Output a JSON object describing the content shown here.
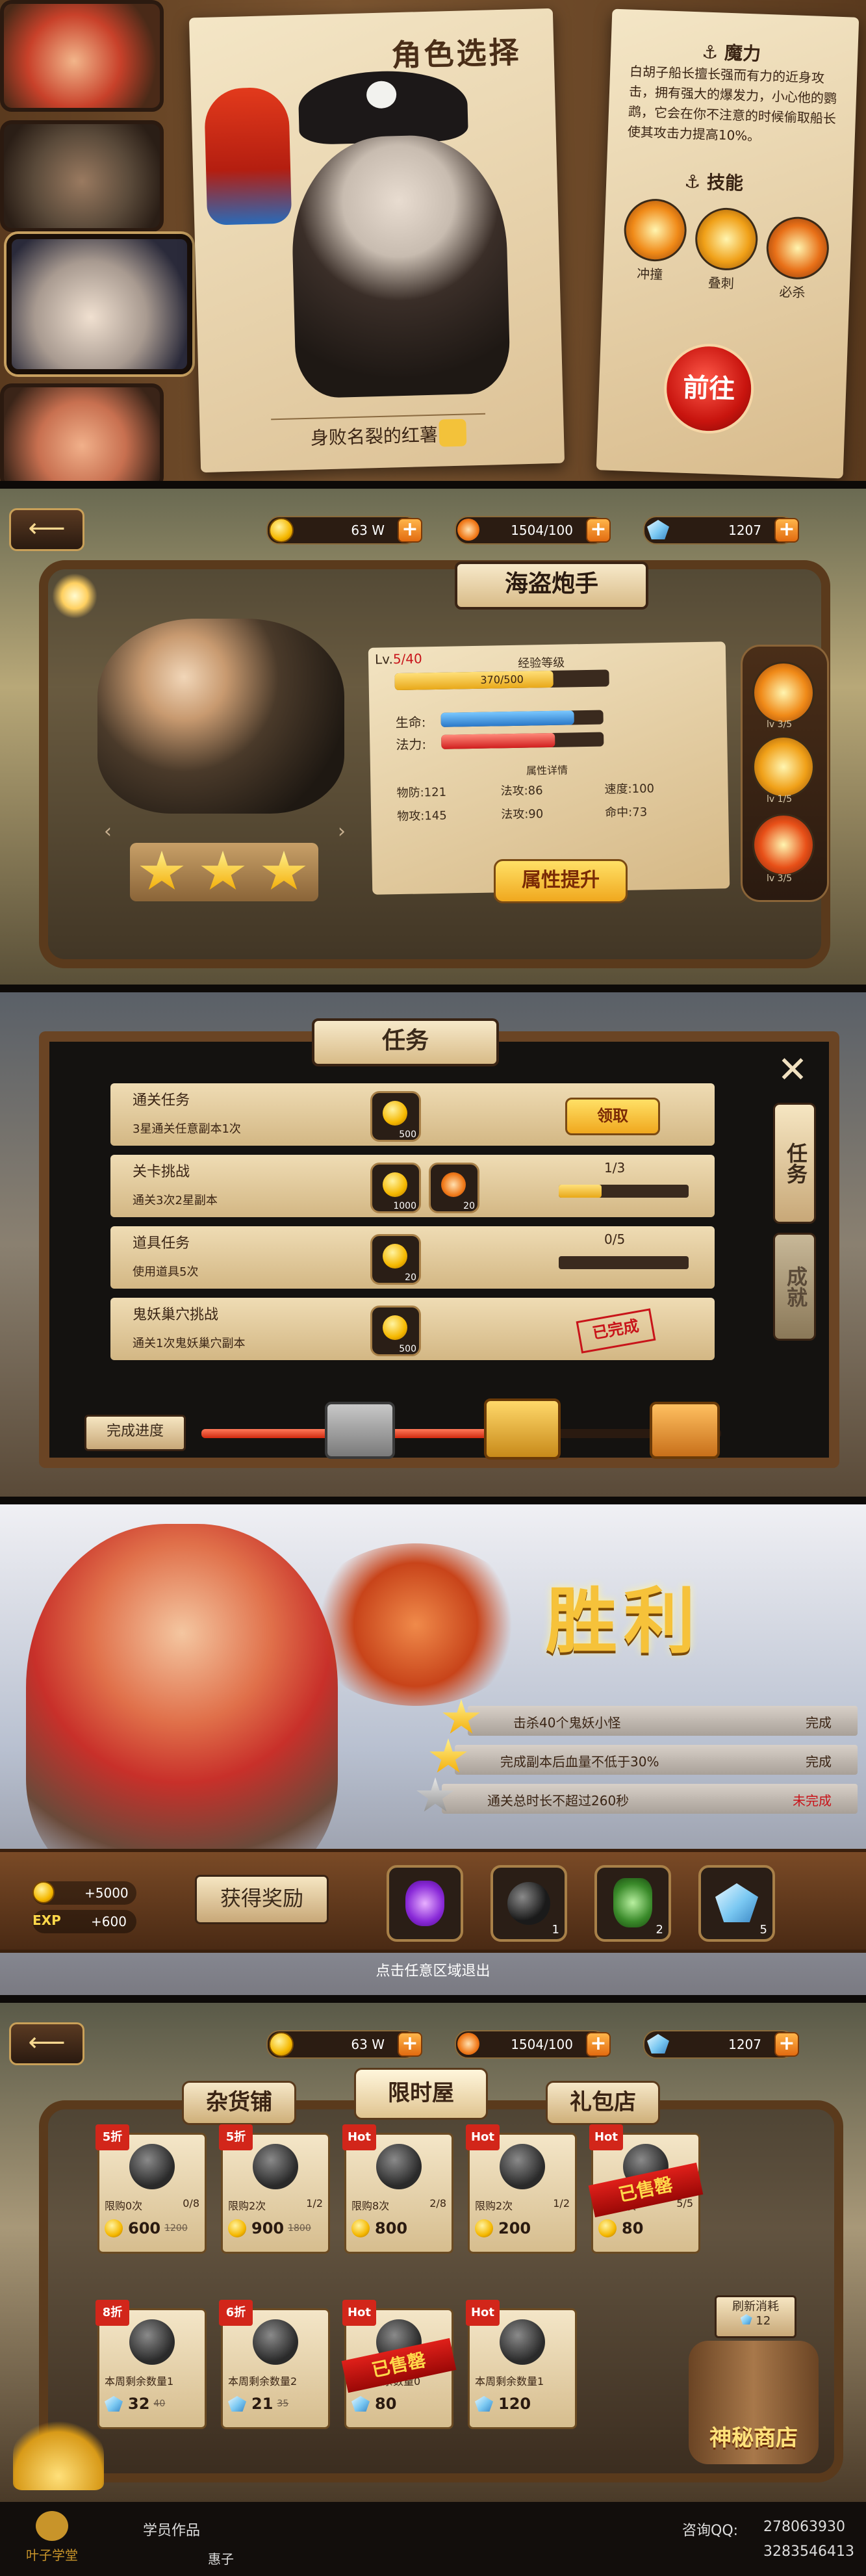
{
  "p1": {
    "title": "角色选择",
    "character_name": "身败名裂的红薯",
    "ability_header": "魔力",
    "description": "白胡子船长擅长强而有力的近身攻击，拥有强大的爆发力，小心他的鹦鹉，它会在你不注意的时候偷取船长使其攻击力提高10%。",
    "skills_header": "技能",
    "skills": [
      "冲撞",
      "叠刺",
      "必杀"
    ],
    "go_button": "前往"
  },
  "p2": {
    "resources": {
      "gold": "63 W",
      "stamina": "1504/100",
      "gems": "1207"
    },
    "title": "海盗炮手",
    "level_label": "Lv.",
    "level_value": "5/40",
    "exp_label": "经验等级",
    "exp_value": "370/500",
    "exp_fraction": 0.74,
    "hp_label": "生命:",
    "mp_label": "法力:",
    "hp_fraction": 0.82,
    "mp_fraction": 0.7,
    "attr_header": "属性详情",
    "attrs": [
      {
        "label": "物防:",
        "value": "121"
      },
      {
        "label": "法攻:",
        "value": "86"
      },
      {
        "label": "速度:",
        "value": "100"
      },
      {
        "label": "物攻:",
        "value": "145"
      },
      {
        "label": "法攻:",
        "value": "90"
      },
      {
        "label": "命中:",
        "value": "73"
      }
    ],
    "upgrade_button": "属性提升",
    "skill_levels": [
      "lv 3/5",
      "lv 1/5",
      "lv 3/5"
    ],
    "stars": 3
  },
  "p3": {
    "title": "任务",
    "quests": [
      {
        "name": "通关任务",
        "desc": "3星通关任意副本1次",
        "reward1": "500",
        "reward2": "",
        "status": "领取",
        "progress": "",
        "fraction": 1
      },
      {
        "name": "关卡挑战",
        "desc": "通关3次2星副本",
        "reward1": "1000",
        "reward2": "20",
        "status": "",
        "progress": "1/3",
        "fraction": 0.33
      },
      {
        "name": "道具任务",
        "desc": "使用道具5次",
        "reward1": "20",
        "reward2": "",
        "status": "",
        "progress": "0/5",
        "fraction": 0
      },
      {
        "name": "鬼妖巢穴挑战",
        "desc": "通关1次鬼妖巢穴副本",
        "reward1": "500",
        "reward2": "",
        "status": "已完成",
        "progress": "",
        "fraction": 1
      }
    ],
    "side_tabs": [
      "任务",
      "成就"
    ],
    "progress_label": "完成进度"
  },
  "p4": {
    "title": "胜利",
    "goals": [
      {
        "text": "击杀40个鬼妖小怪",
        "status": "完成"
      },
      {
        "text": "完成副本后血量不低于30%",
        "status": "完成"
      },
      {
        "text": "通关总时长不超过260秒",
        "status": "未完成"
      }
    ],
    "reward_label": "获得奖励",
    "gold_gain": "+5000",
    "exp_label": "EXP",
    "exp_gain": "+600",
    "reward_counts": [
      "",
      "1",
      "2",
      "5"
    ],
    "exit_hint": "点击任意区域退出"
  },
  "p5": {
    "resources": {
      "gold": "63 W",
      "stamina": "1504/100",
      "gems": "1207"
    },
    "tabs": [
      "杂货铺",
      "限时屋",
      "礼包店"
    ],
    "items_row1": [
      {
        "ribbon": "5折",
        "limit": "限购0次",
        "count": "0/8",
        "price": "600",
        "old": "1200",
        "cur": "coin"
      },
      {
        "ribbon": "5折",
        "limit": "限购2次",
        "count": "1/2",
        "price": "900",
        "old": "1800",
        "cur": "coin"
      },
      {
        "ribbon": "Hot",
        "limit": "限购8次",
        "count": "2/8",
        "price": "800",
        "old": "",
        "cur": "coin"
      },
      {
        "ribbon": "Hot",
        "limit": "限购2次",
        "count": "1/2",
        "price": "200",
        "old": "",
        "cur": "coin"
      },
      {
        "ribbon": "Hot",
        "limit": "限购5次",
        "count": "5/5",
        "price": "80",
        "old": "",
        "cur": "coin",
        "sold": "已售罄"
      }
    ],
    "items_row2": [
      {
        "ribbon": "8折",
        "limit": "本周剩余数量1",
        "price": "32",
        "old": "40",
        "cur": "gem"
      },
      {
        "ribbon": "6折",
        "limit": "本周剩余数量2",
        "price": "21",
        "old": "35",
        "cur": "gem"
      },
      {
        "ribbon": "Hot",
        "limit": "本周剩余数量0",
        "price": "80",
        "old": "",
        "cur": "gem",
        "sold": "已售罄"
      },
      {
        "ribbon": "Hot",
        "limit": "本周剩余数量1",
        "price": "120",
        "old": "",
        "cur": "gem"
      }
    ],
    "refresh_label": "刷新消耗",
    "refresh_cost": "12",
    "mystery_shop": "神秘商店"
  },
  "footer": {
    "brand": "叶子学堂",
    "label": "学员作品",
    "author": "惠子",
    "contact_label": "咨询QQ:",
    "qq1": "278063930",
    "qq2": "3283546413"
  }
}
